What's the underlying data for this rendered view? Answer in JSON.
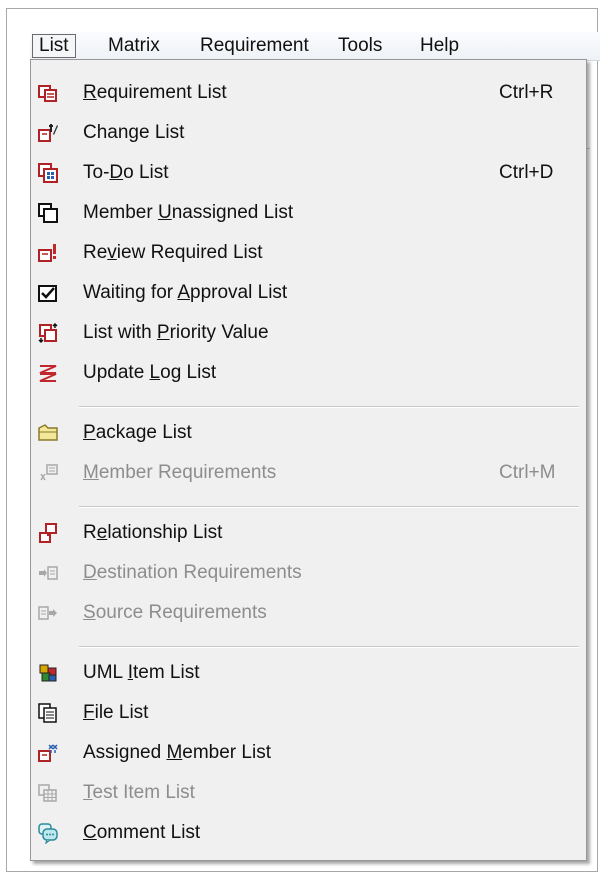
{
  "menubar": {
    "items": [
      "List",
      "Matrix",
      "Requirement",
      "Tools",
      "Help"
    ],
    "active": "List"
  },
  "menu": {
    "rows": [
      {
        "pre": "",
        "acc": "R",
        "post": "equirement List",
        "shortcut": "Ctrl+R",
        "enabled": true,
        "icon": "requirement-list-icon"
      },
      {
        "pre": "Chan",
        "acc": "g",
        "post": "e List",
        "shortcut": "",
        "enabled": true,
        "icon": "change-list-icon"
      },
      {
        "pre": "To-",
        "acc": "D",
        "post": "o List",
        "shortcut": "Ctrl+D",
        "enabled": true,
        "icon": "todo-list-icon"
      },
      {
        "pre": "Member ",
        "acc": "U",
        "post": "nassigned List",
        "shortcut": "",
        "enabled": true,
        "icon": "member-unassigned-icon"
      },
      {
        "pre": "Re",
        "acc": "v",
        "post": "iew Required List",
        "shortcut": "",
        "enabled": true,
        "icon": "review-required-icon"
      },
      {
        "pre": "Waiting for ",
        "acc": "A",
        "post": "pproval List",
        "shortcut": "",
        "enabled": true,
        "icon": "approval-checkbox-icon"
      },
      {
        "pre": "List with ",
        "acc": "P",
        "post": "riority Value",
        "shortcut": "",
        "enabled": true,
        "icon": "priority-value-icon"
      },
      {
        "pre": "Update ",
        "acc": "L",
        "post": "og List",
        "shortcut": "",
        "enabled": true,
        "icon": "update-log-icon"
      },
      {
        "pre": "",
        "acc": "P",
        "post": "ackage List",
        "shortcut": "",
        "enabled": true,
        "icon": "package-folder-icon"
      },
      {
        "pre": "",
        "acc": "M",
        "post": "ember Requirements",
        "shortcut": "Ctrl+M",
        "enabled": false,
        "icon": "member-requirements-icon"
      },
      {
        "pre": "R",
        "acc": "e",
        "post": "lationship List",
        "shortcut": "",
        "enabled": true,
        "icon": "relationship-list-icon"
      },
      {
        "pre": "",
        "acc": "D",
        "post": "estination Requirements",
        "shortcut": "",
        "enabled": false,
        "icon": "destination-arrow-icon"
      },
      {
        "pre": "",
        "acc": "S",
        "post": "ource Requirements",
        "shortcut": "",
        "enabled": false,
        "icon": "source-arrow-icon"
      },
      {
        "pre": "UML ",
        "acc": "I",
        "post": "tem List",
        "shortcut": "",
        "enabled": true,
        "icon": "uml-item-icon"
      },
      {
        "pre": "",
        "acc": "F",
        "post": "ile List",
        "shortcut": "",
        "enabled": true,
        "icon": "file-list-icon"
      },
      {
        "pre": "Assigned ",
        "acc": "M",
        "post": "ember List",
        "shortcut": "",
        "enabled": true,
        "icon": "assigned-member-icon"
      },
      {
        "pre": "",
        "acc": "T",
        "post": "est Item List",
        "shortcut": "",
        "enabled": false,
        "icon": "test-item-grid-icon"
      },
      {
        "pre": "",
        "acc": "C",
        "post": "omment List",
        "shortcut": "",
        "enabled": true,
        "icon": "comment-list-icon"
      }
    ]
  },
  "colors": {
    "accent_red": "#c0282d",
    "accent_blue": "#2a5fb0",
    "disabled_text": "#8d8d8d"
  }
}
